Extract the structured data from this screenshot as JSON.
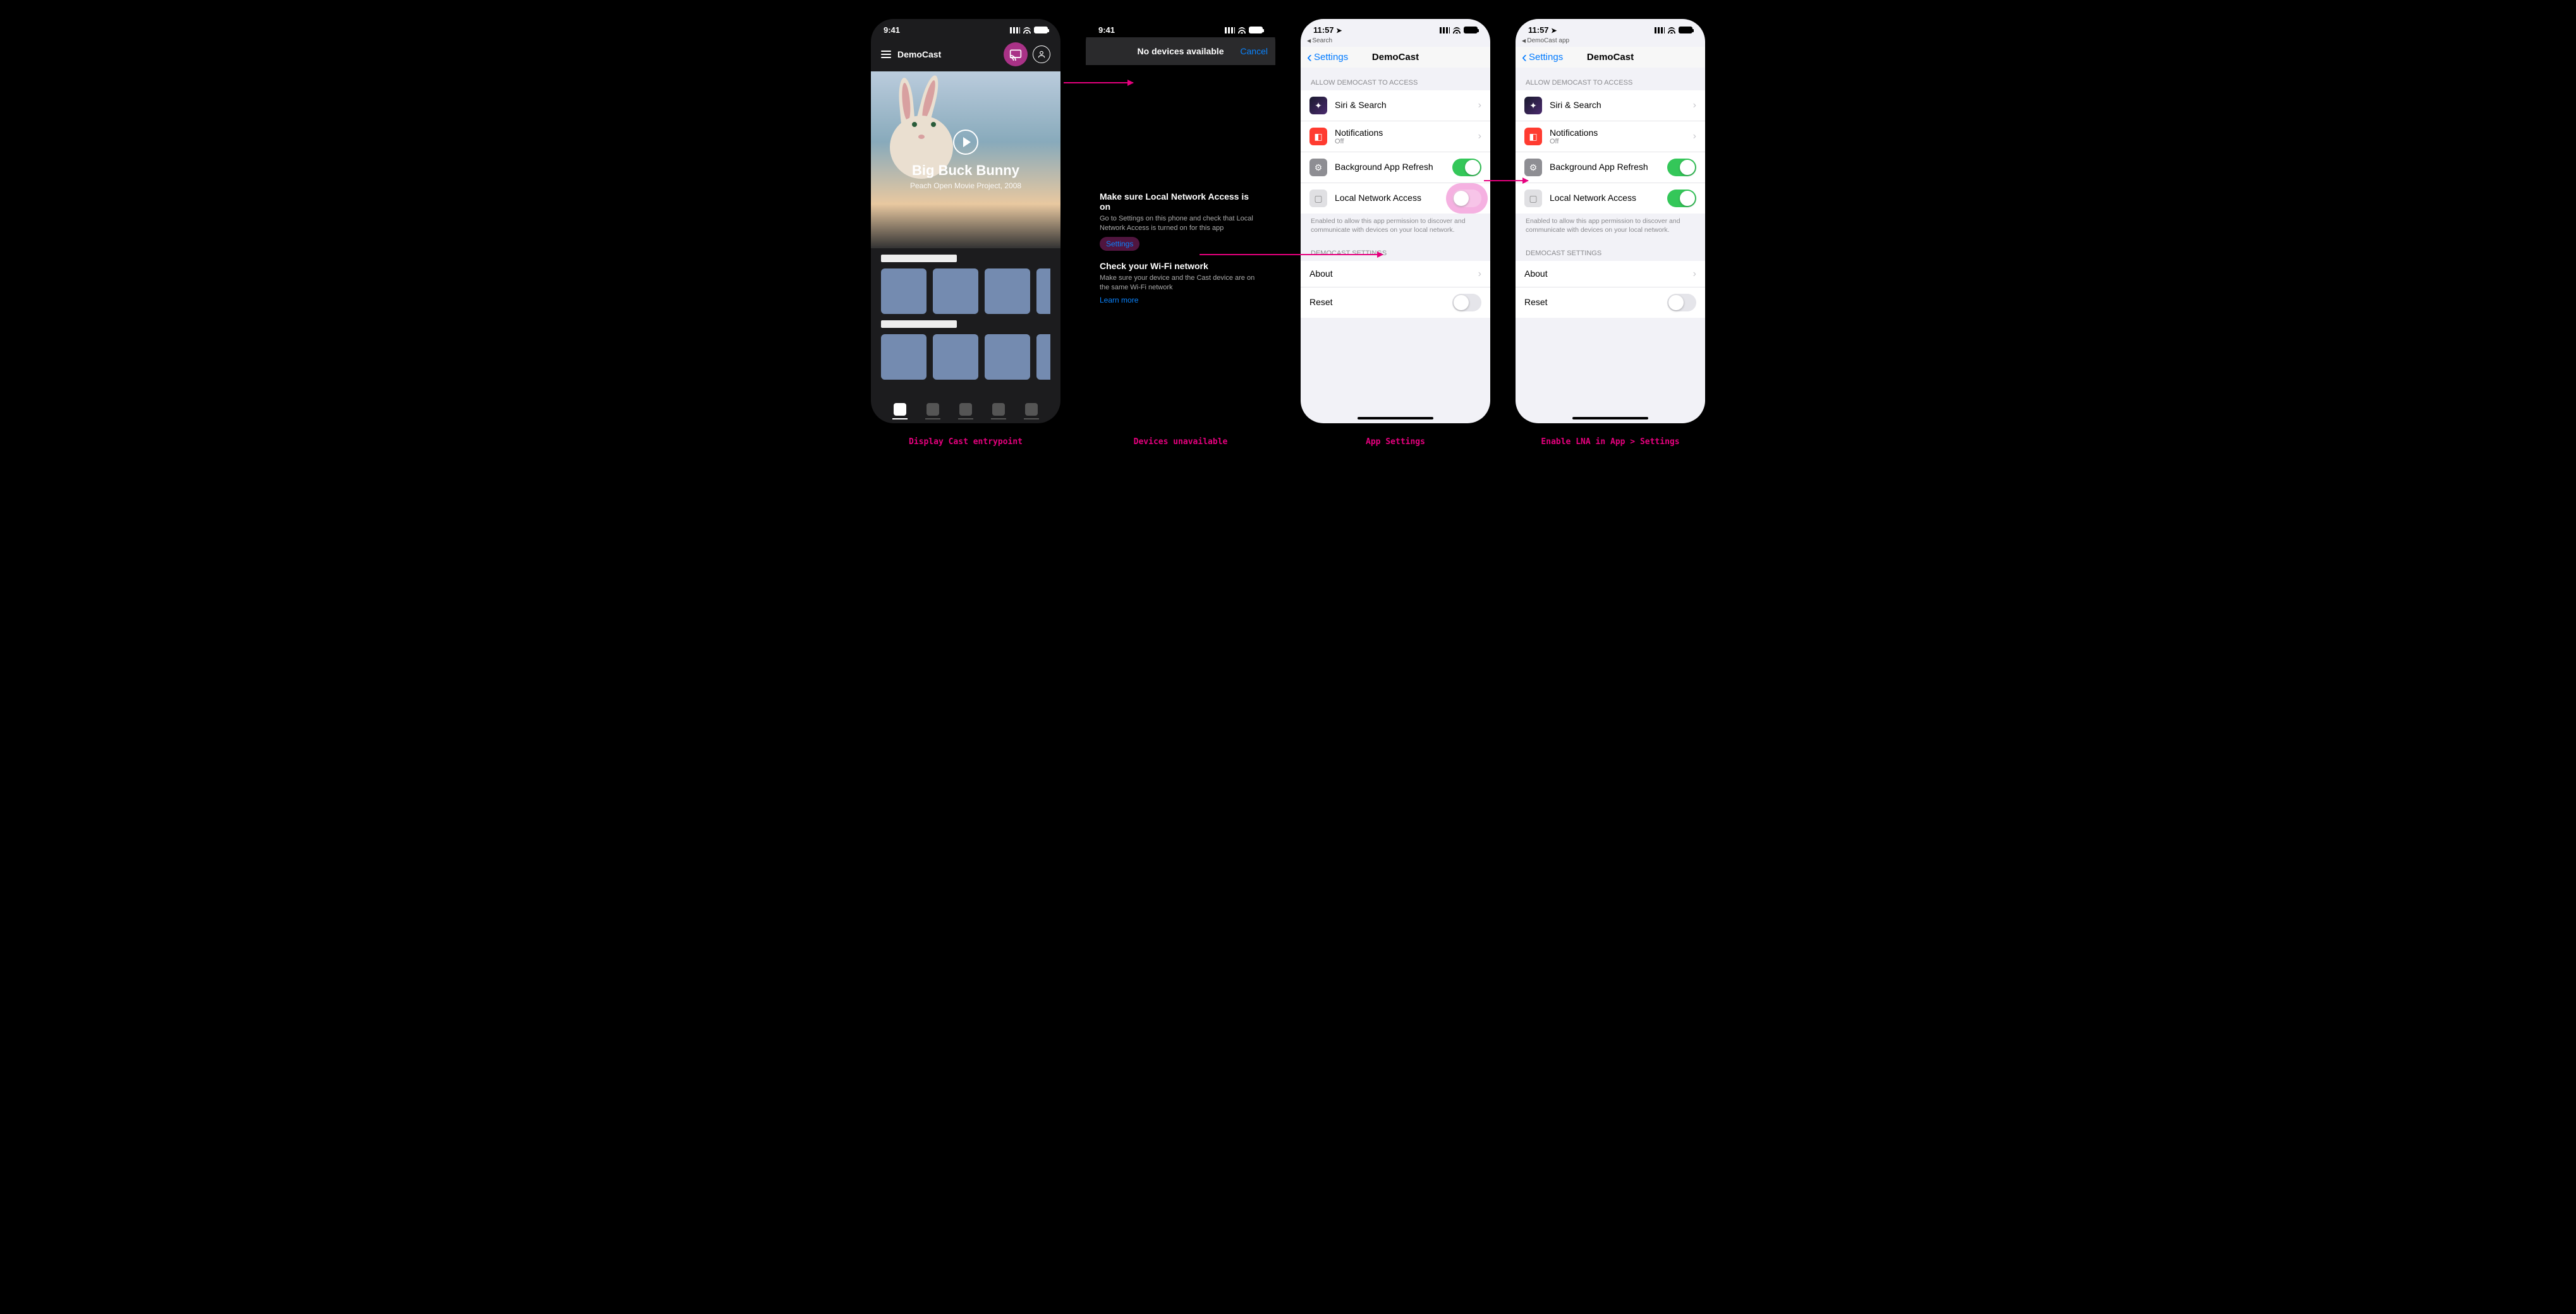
{
  "captions": {
    "p1": "Display Cast entrypoint",
    "p2": "Devices unavailable",
    "p3": "App Settings",
    "p4": "Enable LNA in App > Settings"
  },
  "status": {
    "time941": "9:41",
    "time1157": "11:57"
  },
  "breadcrumbs": {
    "search": "Search",
    "democast_app": "DemoCast app"
  },
  "p1": {
    "app_name": "DemoCast",
    "hero_title": "Big Buck Bunny",
    "hero_sub": "Peach Open Movie Project, 2008"
  },
  "p2": {
    "header": "No devices available",
    "cancel": "Cancel",
    "h1": "Make sure Local Network Access is on",
    "h1_body": "Go to Settings on this phone and check that Local Network Access is turned on for this app",
    "settings_link": "Settings",
    "h2": "Check your Wi-Fi network",
    "h2_body": "Make sure your device and the Cast device are on the same Wi-Fi network",
    "learn_more": "Learn more"
  },
  "settings": {
    "back": "Settings",
    "title": "DemoCast",
    "group_access": "ALLOW DEMOCAST TO ACCESS",
    "siri": "Siri & Search",
    "notifications": "Notifications",
    "notifications_sub": "Off",
    "bg_refresh": "Background App Refresh",
    "lna": "Local Network Access",
    "lna_foot": "Enabled to allow this app permission to discover and communicate with devices on your local network.",
    "group_app": "DEMOCAST SETTINGS",
    "about": "About",
    "reset": "Reset"
  }
}
